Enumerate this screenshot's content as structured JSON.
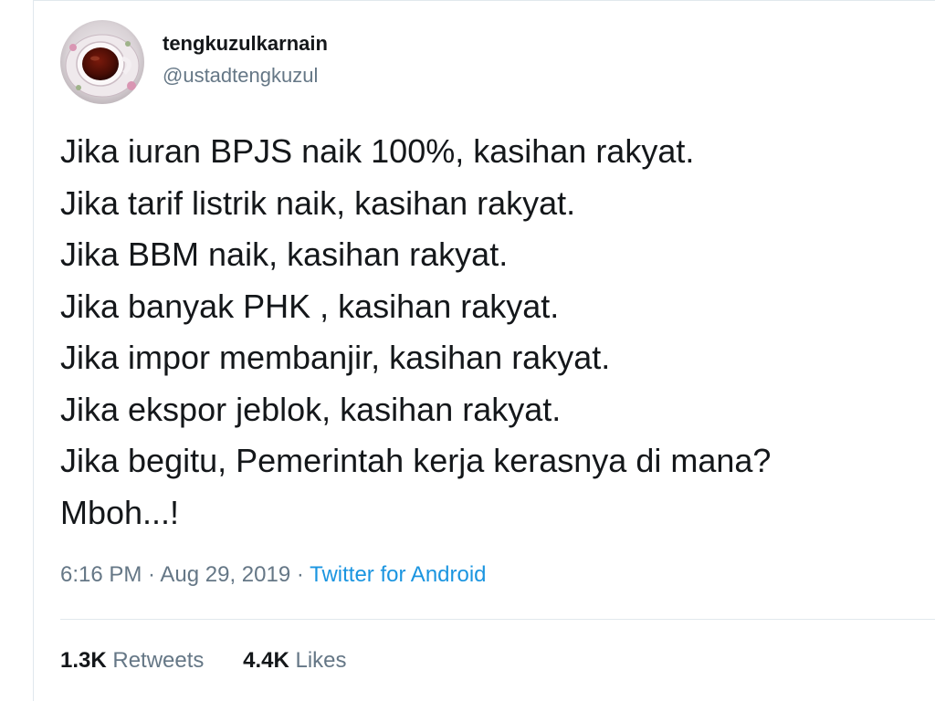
{
  "user": {
    "display_name": "tengkuzulkarnain",
    "handle": "@ustadtengkuzul",
    "avatar": "teacup-photo"
  },
  "tweet": {
    "lines": [
      "Jika iuran BPJS naik 100%, kasihan rakyat.",
      "Jika tarif listrik naik, kasihan rakyat.",
      "Jika BBM naik, kasihan rakyat.",
      "Jika banyak PHK , kasihan rakyat.",
      "Jika impor membanjir, kasihan rakyat.",
      "Jika ekspor jeblok, kasihan rakyat.",
      "Jika begitu, Pemerintah kerja kerasnya di mana?",
      "Mboh...!"
    ]
  },
  "meta": {
    "time": "6:16 PM",
    "separator": " · ",
    "date": "Aug 29, 2019",
    "source": "Twitter for Android"
  },
  "stats": {
    "retweets_count": "1.3K",
    "retweets_label": "Retweets",
    "likes_count": "4.4K",
    "likes_label": "Likes"
  },
  "colors": {
    "text": "#14171a",
    "secondary": "#657786",
    "link": "#1b95e0",
    "border": "#e1e8ed"
  }
}
